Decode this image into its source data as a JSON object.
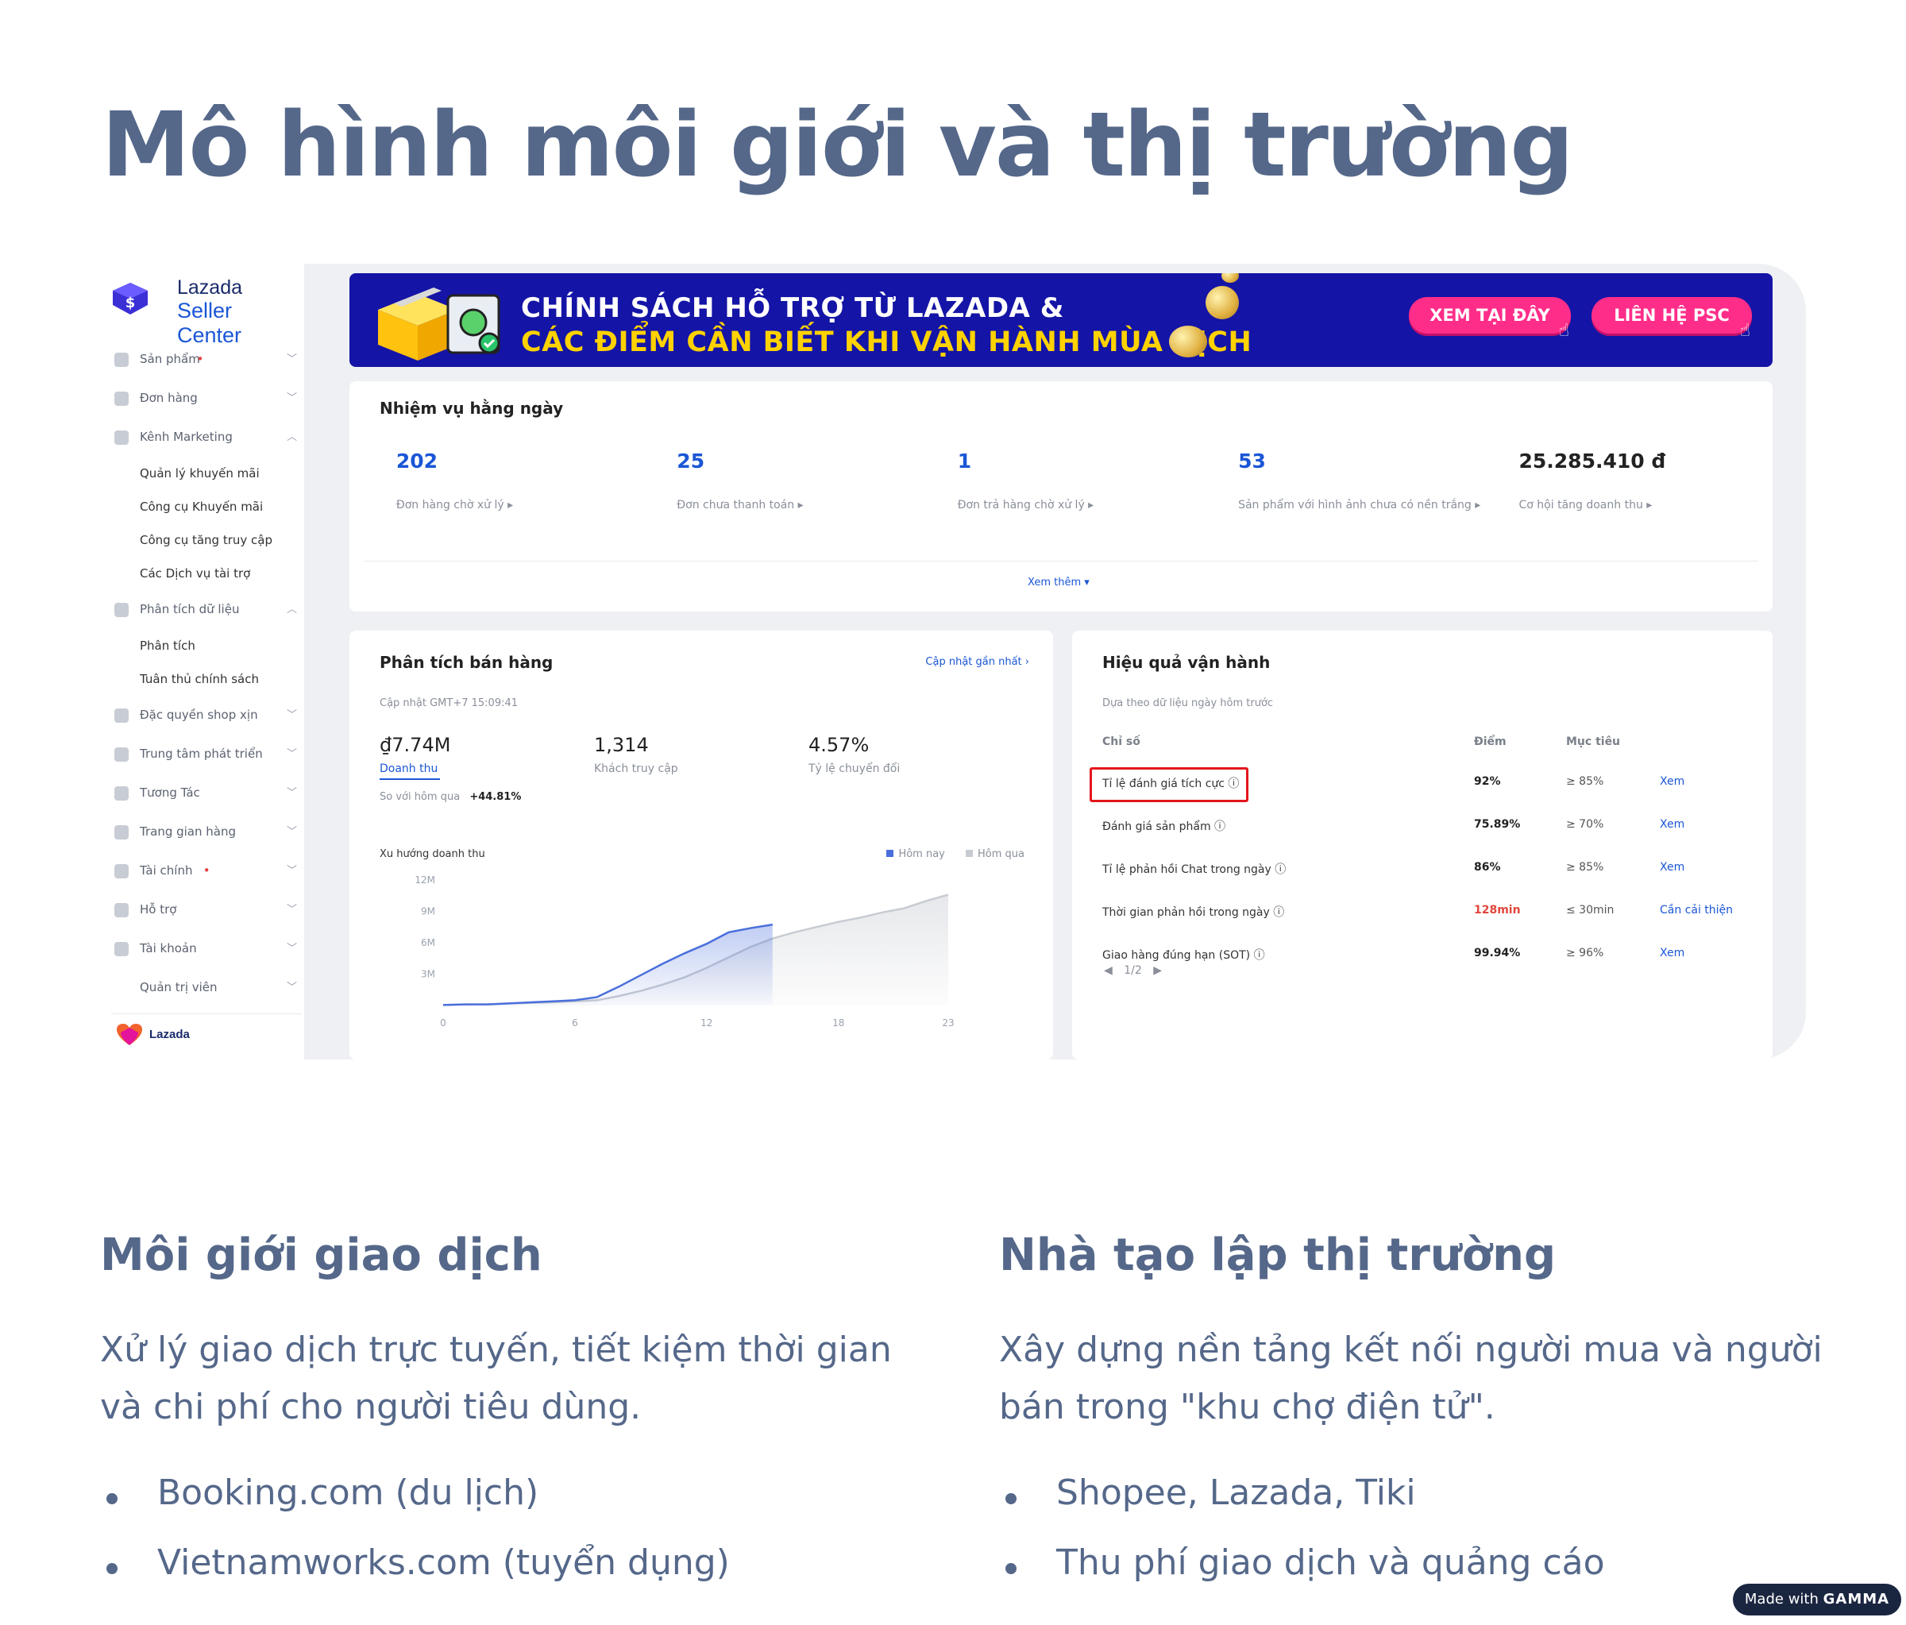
{
  "slide": {
    "title": "Mô hình môi giới và thị trường",
    "made_with": "Made with",
    "made_with_brand": "GAMMA"
  },
  "sidebar": {
    "brand_line1": "Lazada",
    "brand_line2": "Seller Center",
    "items": [
      {
        "label": "Sản phẩm",
        "dot": true,
        "chevron": "down",
        "sub": []
      },
      {
        "label": "Đơn hàng",
        "dot": false,
        "chevron": "down",
        "sub": []
      },
      {
        "label": "Kênh Marketing",
        "dot": false,
        "chevron": "up",
        "sub": [
          "Quản lý khuyến mãi",
          "Công cụ Khuyến mãi",
          "Công cụ tăng truy cập",
          "Các Dịch vụ tài trợ"
        ]
      },
      {
        "label": "Phân tích dữ liệu",
        "dot": false,
        "chevron": "up",
        "sub": [
          "Phân tích",
          "Tuân thủ chính sách"
        ]
      },
      {
        "label": "Đặc quyền shop xịn",
        "dot": false,
        "chevron": "down",
        "sub": []
      },
      {
        "label": "Trung tâm phát triển",
        "dot": false,
        "chevron": "down",
        "sub": []
      },
      {
        "label": "Tương Tác",
        "dot": false,
        "chevron": "down",
        "sub": []
      },
      {
        "label": "Trang gian hàng",
        "dot": false,
        "chevron": "down",
        "sub": []
      },
      {
        "label": "Tài chính",
        "dot": true,
        "chevron": "down",
        "sub": []
      },
      {
        "label": "Hỗ trợ",
        "dot": false,
        "chevron": "down",
        "sub": []
      },
      {
        "label": "Tài khoản",
        "dot": false,
        "chevron": "down",
        "sub": []
      },
      {
        "label": "Quản trị viên",
        "dot": false,
        "chevron": "down",
        "sub": [],
        "indent": true
      }
    ],
    "footer_label": "Lazada"
  },
  "banner": {
    "line1": "CHÍNH SÁCH HỖ TRỢ TỪ LAZADA &",
    "line2": "CÁC ĐIỂM CẦN BIẾT KHI VẬN HÀNH MÙA DỊCH",
    "button1": "XEM TẠI ĐÂY",
    "button2": "LIÊN HỆ PSC"
  },
  "tasks": {
    "title": "Nhiệm vụ hằng ngày",
    "kpis": [
      {
        "value": "202",
        "label": "Đơn hàng chờ xử lý ▸"
      },
      {
        "value": "25",
        "label": "Đơn chưa thanh toán ▸"
      },
      {
        "value": "1",
        "label": "Đơn trả hàng chờ xử lý ▸"
      },
      {
        "value": "53",
        "label": "Sản phẩm với hình ảnh chưa có nền trắng ▸"
      },
      {
        "value": "25.285.410 đ",
        "label": "Cơ hội tăng doanh thu ▸"
      }
    ],
    "see_more": "Xem thêm ▾"
  },
  "sales": {
    "title": "Phân tích bán hàng",
    "updated_link": "Cập nhật gần nhất ›",
    "updated_time": "Cập nhật GMT+7 15:09:41",
    "metrics": [
      {
        "value": "₫7.74M",
        "label": "Doanh thu"
      },
      {
        "value": "1,314",
        "label": "Khách truy cập"
      },
      {
        "value": "4.57%",
        "label": "Tỷ lệ chuyển đổi"
      }
    ],
    "compare_label": "So với hôm qua",
    "compare_value": "+44.81%",
    "chart_title": "Xu hướng doanh thu",
    "legend_today": "Hôm nay",
    "legend_yesterday": "Hôm qua"
  },
  "operations": {
    "title": "Hiệu quả vận hành",
    "subtitle": "Dựa theo dữ liệu ngày hôm trước",
    "col_metric": "Chỉ số",
    "col_score": "Điểm",
    "col_target": "Mục tiêu",
    "rows": [
      {
        "name": "Tỉ lệ đánh giá tích cực ⓘ",
        "score": "92%",
        "target": "≥ 85%",
        "action": "Xem",
        "bad": false
      },
      {
        "name": "Đánh giá sản phẩm ⓘ",
        "score": "75.89%",
        "target": "≥ 70%",
        "action": "Xem",
        "bad": false
      },
      {
        "name": "Tỉ lệ phản hồi Chat trong ngày ⓘ",
        "score": "86%",
        "target": "≥ 85%",
        "action": "Xem",
        "bad": false
      },
      {
        "name": "Thời gian phản hồi trong ngày ⓘ",
        "score": "128min",
        "target": "≤ 30min",
        "action": "Cần cải thiện",
        "bad": true
      },
      {
        "name": "Giao hàng đúng hạn (SOT) ⓘ",
        "score": "99.94%",
        "target": "≥ 96%",
        "action": "Xem",
        "bad": false
      }
    ],
    "pagination": "1/2"
  },
  "chart_data": {
    "type": "area",
    "title": "Xu hướng doanh thu",
    "xlabel": "",
    "ylabel": "",
    "x_ticks": [
      "0",
      "6",
      "12",
      "18",
      "23"
    ],
    "y_ticks": [
      "3M",
      "6M",
      "9M",
      "12M"
    ],
    "xlim": [
      0,
      23
    ],
    "ylim": [
      0,
      12
    ],
    "grid": false,
    "legend": "top-right",
    "series": [
      {
        "name": "Hôm nay",
        "color": "#4a6fdc",
        "x": [
          0,
          1,
          2,
          3,
          4,
          5,
          6,
          7,
          8,
          9,
          10,
          11,
          12,
          13,
          14,
          15
        ],
        "y": [
          0.05,
          0.1,
          0.1,
          0.2,
          0.3,
          0.4,
          0.5,
          0.8,
          1.8,
          2.9,
          4.0,
          5.0,
          5.9,
          7.0,
          7.4,
          7.74
        ]
      },
      {
        "name": "Hôm qua",
        "color": "#c8cbd2",
        "x": [
          0,
          1,
          2,
          3,
          4,
          5,
          6,
          7,
          8,
          9,
          10,
          11,
          12,
          13,
          14,
          15,
          16,
          17,
          18,
          19,
          20,
          21,
          22,
          23
        ],
        "y": [
          0.05,
          0.1,
          0.1,
          0.2,
          0.25,
          0.3,
          0.4,
          0.5,
          0.9,
          1.4,
          2.0,
          2.7,
          3.6,
          4.6,
          5.6,
          6.4,
          7.0,
          7.5,
          8.0,
          8.4,
          8.9,
          9.3,
          10.0,
          10.6
        ]
      }
    ]
  },
  "left_column": {
    "title": "Môi giới giao dịch",
    "body": "Xử lý giao dịch trực tuyến, tiết kiệm thời gian và chi phí cho người tiêu dùng.",
    "bullets": [
      "Booking.com (du lịch)",
      "Vietnamworks.com (tuyển dụng)"
    ]
  },
  "right_column": {
    "title": "Nhà tạo lập thị trường",
    "body": "Xây dựng nền tảng kết nối người mua và người bán trong \"khu chợ điện tử\".",
    "bullets": [
      "Shopee, Lazada, Tiki",
      "Thu phí giao dịch và quảng cáo"
    ]
  }
}
